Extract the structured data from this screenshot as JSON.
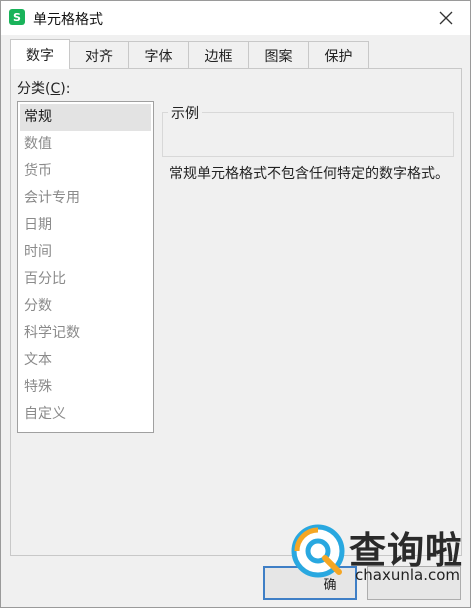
{
  "window": {
    "title": "单元格格式",
    "app_icon_letter": "S",
    "app_icon_color": "#19b35a"
  },
  "tabs": [
    {
      "label": "数字",
      "active": true
    },
    {
      "label": "对齐",
      "active": false
    },
    {
      "label": "字体",
      "active": false
    },
    {
      "label": "边框",
      "active": false
    },
    {
      "label": "图案",
      "active": false
    },
    {
      "label": "保护",
      "active": false
    }
  ],
  "category": {
    "label_prefix": "分类(",
    "label_accel": "C",
    "label_suffix": "):",
    "items": [
      {
        "label": "常规",
        "selected": true
      },
      {
        "label": "数值",
        "selected": false
      },
      {
        "label": "货币",
        "selected": false
      },
      {
        "label": "会计专用",
        "selected": false
      },
      {
        "label": "日期",
        "selected": false
      },
      {
        "label": "时间",
        "selected": false
      },
      {
        "label": "百分比",
        "selected": false
      },
      {
        "label": "分数",
        "selected": false
      },
      {
        "label": "科学记数",
        "selected": false
      },
      {
        "label": "文本",
        "selected": false
      },
      {
        "label": "特殊",
        "selected": false
      },
      {
        "label": "自定义",
        "selected": false
      }
    ]
  },
  "sample": {
    "label": "示例",
    "value": ""
  },
  "description": "常规单元格格式不包含任何特定的数字格式。",
  "buttons": {
    "ok_label": "确",
    "cancel_label": ""
  },
  "watermark": {
    "text": "查询啦",
    "url": "chaxunla.com",
    "accent_color": "#29a8e0",
    "accent_color_2": "#f5a623"
  }
}
